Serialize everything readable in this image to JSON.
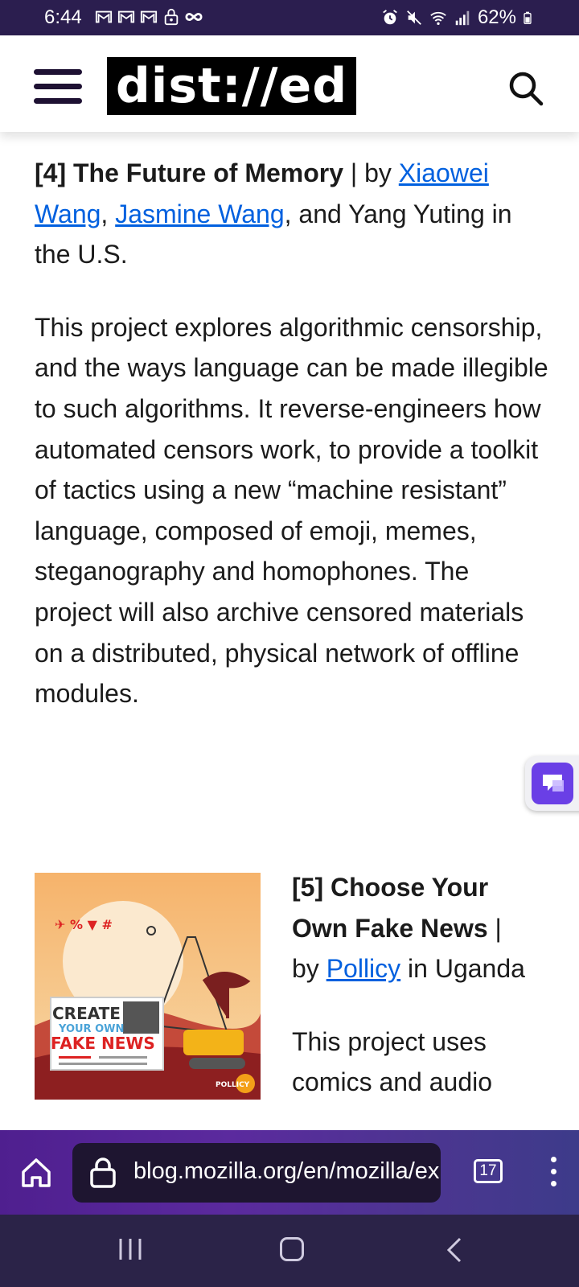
{
  "status_bar": {
    "time": "6:44",
    "battery": "62%",
    "left_icons": [
      "gmail-icon",
      "gmail-icon",
      "gmail-icon",
      "lock-notification-icon",
      "infinity-icon"
    ],
    "right_icons": [
      "alarm-icon",
      "mute-icon",
      "wifi-icon",
      "signal-icon",
      "battery-icon"
    ]
  },
  "header": {
    "logo_text": "dist://ed"
  },
  "article": {
    "entry4": {
      "title": "[4] The Future of Memory",
      "separator": " | by ",
      "author1": "Xiaowei Wang",
      "comma": ", ",
      "author2": "Jasmine Wang",
      "rest": ", and Yang Yuting in the U.S.",
      "description": "This project explores algorithmic censorship, and the ways language can be made illegible to such algorithms. It reverse-engineers how automated censors work, to provide a toolkit of tactics using a new “machine resistant” language, composed of emoji, memes, steganography and homophones. The project will also archive censored materials on a distributed, physical network of offline modules."
    },
    "entry5": {
      "title": "[5] Choose Your Own Fake News",
      "separator": " | by ",
      "author": "Pollicy",
      "rest": " in Uganda",
      "description_start": "This project uses comics and audio",
      "image_text": {
        "line1": "CREATE",
        "line2": "YOUR OWN",
        "line3": "FAKE NEWS",
        "brand": "POLLICY"
      }
    }
  },
  "browser": {
    "url": "blog.mozilla.org/en/mozilla/ex",
    "tab_count": "17"
  },
  "colors": {
    "link": "#0060df",
    "status_bar": "#2b1e4f",
    "toolbar_gradient_start": "#4f1f8f",
    "accent_button": "#6a3fe6"
  }
}
